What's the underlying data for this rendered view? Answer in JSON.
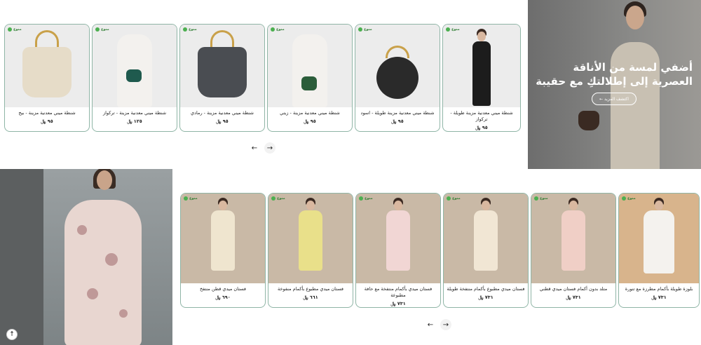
{
  "bags_row": {
    "badge": "منوع",
    "products": [
      {
        "title": "شنطة ميني معدنية مزينة - بيج",
        "price": "٩٥ ﷼"
      },
      {
        "title": "شنطة ميني معدنية مزينة - تركواز",
        "price": "١٢٥ ﷼"
      },
      {
        "title": "شنطة ميني معدنية مزينة - رمادي",
        "price": "٩٥ ﷼"
      },
      {
        "title": "شنطة ميني معدنية مزينة - زيتي",
        "price": "٩٥ ﷼"
      },
      {
        "title": "شنطة ميني معدنية مزينة طويلة - اسود",
        "price": "٩٥ ﷼"
      },
      {
        "title": "شنطة ميني معدنية مزينة طويلة - تركواز",
        "price": "٩٥ ﷼"
      }
    ],
    "prev_arrow": "←",
    "next_arrow": "→"
  },
  "hero": {
    "headline": "أضفي لمسة من الأناقة العصرية إلى إطلالتكِ مع حقيبة",
    "cta_label": "اكتشف المزيد ←"
  },
  "dresses_row": {
    "badge": "منوع",
    "products": [
      {
        "title": "فستان ميدي قطن منتفخ",
        "price": "٦٩٠ ﷼"
      },
      {
        "title": "فستان ميدي مطبوع بأكمام منفوخة",
        "price": "٦٦١ ﷼"
      },
      {
        "title": "فستان ميدي بأكمام منتفخة مع حافة مطبوعة",
        "price": "٧٣١ ﷼"
      },
      {
        "title": "فستان ميدي مطبوع بأكمام منتفخة طويلة",
        "price": "٧٣١ ﷼"
      },
      {
        "title": "متلد بدون أكمام فستان ميدي قطني",
        "price": "٧٣١ ﷼"
      },
      {
        "title": "بلوزة طويلة بأكمام مطرزة مع تنورة",
        "price": "٧٣١ ﷼"
      }
    ],
    "prev_arrow": "←",
    "next_arrow": "→"
  },
  "scroll_top": "↑",
  "icons": {
    "badge": "leaf-badge-icon",
    "scroll_top": "arrow-up-icon"
  },
  "colors": {
    "card_border": "#8fb5a6",
    "badge_green": "#2e7d32"
  }
}
